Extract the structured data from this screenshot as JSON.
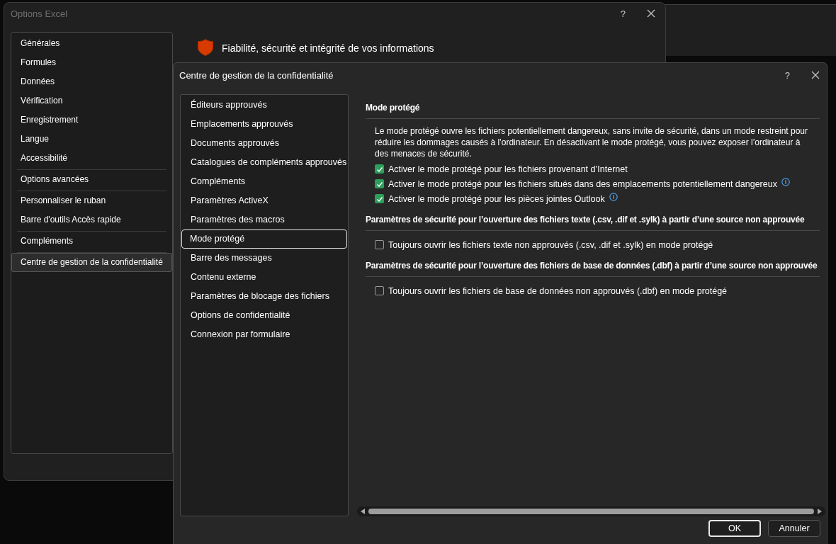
{
  "back_window": {
    "title": "Options Excel",
    "help": "?",
    "sidebar": {
      "groups": [
        {
          "items": [
            {
              "label": "Générales",
              "selected": false
            },
            {
              "label": "Formules",
              "selected": false
            },
            {
              "label": "Données",
              "selected": false
            },
            {
              "label": "Vérification",
              "selected": false
            },
            {
              "label": "Enregistrement",
              "selected": false
            },
            {
              "label": "Langue",
              "selected": false
            },
            {
              "label": "Accessibilité",
              "selected": false
            }
          ]
        },
        {
          "items": [
            {
              "label": "Options avancées",
              "selected": false
            }
          ]
        },
        {
          "items": [
            {
              "label": "Personnaliser le ruban",
              "selected": false
            },
            {
              "label": "Barre d'outils Accès rapide",
              "selected": false
            }
          ]
        },
        {
          "items": [
            {
              "label": "Compléments",
              "selected": false
            }
          ]
        },
        {
          "items": [
            {
              "label": "Centre de gestion de la confidentialité",
              "selected": true
            }
          ]
        }
      ]
    },
    "header": "Fiabilité, sécurité et intégrité de vos informations"
  },
  "dialog": {
    "title": "Centre de gestion de la confidentialité",
    "help": "?",
    "nav": [
      {
        "label": "Éditeurs approuvés",
        "selected": false
      },
      {
        "label": "Emplacements approuvés",
        "selected": false
      },
      {
        "label": "Documents approuvés",
        "selected": false
      },
      {
        "label": "Catalogues de compléments approuvés",
        "selected": false
      },
      {
        "label": "Compléments",
        "selected": false
      },
      {
        "label": "Paramètres ActiveX",
        "selected": false
      },
      {
        "label": "Paramètres des macros",
        "selected": false
      },
      {
        "label": "Mode protégé",
        "selected": true
      },
      {
        "label": "Barre des messages",
        "selected": false
      },
      {
        "label": "Contenu externe",
        "selected": false
      },
      {
        "label": "Paramètres de blocage des fichiers",
        "selected": false
      },
      {
        "label": "Options de confidentialité",
        "selected": false
      },
      {
        "label": "Connexion par formulaire",
        "selected": false
      }
    ],
    "sections": [
      {
        "heading": "Mode protégé",
        "description": "Le mode protégé ouvre les fichiers potentiellement dangereux, sans invite de sécurité, dans un mode restreint pour réduire les dommages causés à l’ordinateur. En désactivant le mode protégé, vous pouvez exposer l’ordinateur à des menaces de sécurité.",
        "options": [
          {
            "label": "Activer le mode protégé pour les fichiers provenant d’Internet",
            "checked": true,
            "info": false
          },
          {
            "label": "Activer le mode protégé pour les fichiers situés dans des emplacements potentiellement dangereux",
            "checked": true,
            "info": true
          },
          {
            "label": "Activer le mode protégé pour les pièces jointes Outlook",
            "checked": true,
            "info": true
          }
        ]
      },
      {
        "heading": "Paramètres de sécurité pour l’ouverture des fichiers texte (.csv, .dif et .sylk) à partir d’une source non approuvée",
        "options": [
          {
            "label": "Toujours ouvrir les fichiers texte non approuvés (.csv, .dif et .sylk) en mode protégé",
            "checked": false,
            "info": false
          }
        ]
      },
      {
        "heading": "Paramètres de sécurité pour l’ouverture des fichiers de base de données (.dbf) à partir d’une source non approuvée",
        "options": [
          {
            "label": "Toujours ouvrir les fichiers de base de données non approuvés (.dbf) en mode protégé",
            "checked": false,
            "info": false
          }
        ]
      }
    ],
    "buttons": [
      {
        "label": "OK",
        "default": true
      },
      {
        "label": "Annuler",
        "default": false
      }
    ]
  }
}
